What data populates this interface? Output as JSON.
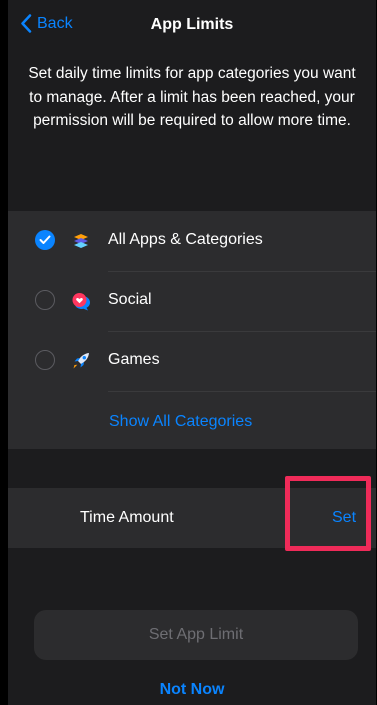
{
  "nav": {
    "back_label": "Back",
    "title": "App Limits"
  },
  "description": "Set daily time limits for app categories you want to manage. After a limit has been reached, your permission will be required to allow more time.",
  "categories": [
    {
      "label": "All Apps & Categories",
      "icon": "stack-icon",
      "selected": true
    },
    {
      "label": "Social",
      "icon": "chat-bubble-icon",
      "selected": false
    },
    {
      "label": "Games",
      "icon": "rocket-icon",
      "selected": false
    }
  ],
  "show_all_label": "Show All Categories",
  "time_amount": {
    "label": "Time Amount",
    "action_label": "Set"
  },
  "set_app_limit_label": "Set App Limit",
  "not_now_label": "Not Now",
  "colors": {
    "accent": "#0a84ff",
    "highlight": "#ef2b59",
    "background": "#1c1c1e",
    "cell": "#2c2c2e"
  }
}
